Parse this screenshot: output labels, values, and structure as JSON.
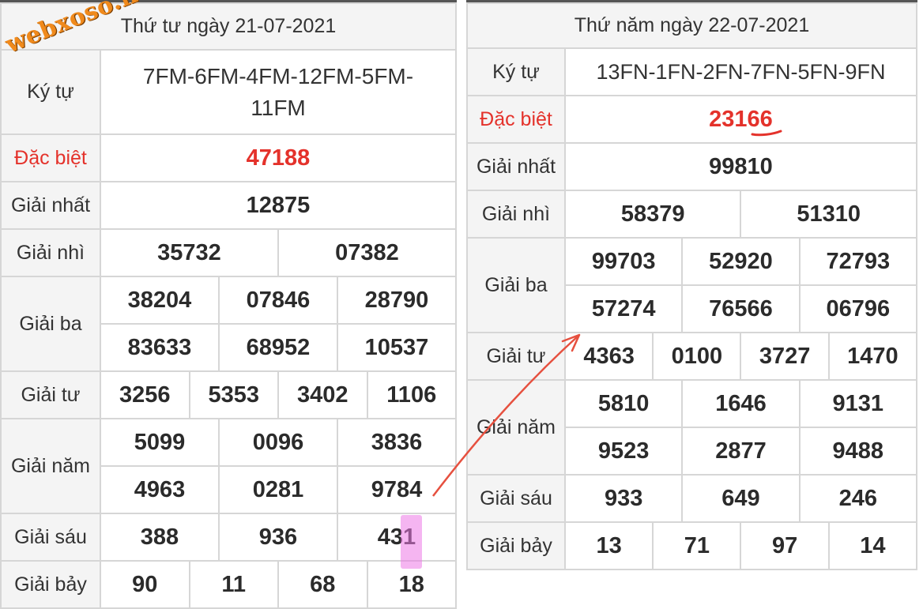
{
  "watermark": "webxoso.net",
  "left": {
    "header": "Thứ tư ngày 21-07-2021",
    "ky_tu_label": "Ký tự",
    "ky_tu_line1": "7FM-6FM-4FM-12FM-5FM-",
    "ky_tu_line2": "11FM",
    "dac_biet_label": "Đặc biệt",
    "dac_biet": "47188",
    "nhat_label": "Giải nhất",
    "nhat": "12875",
    "nhi_label": "Giải nhì",
    "nhi": [
      "35732",
      "07382"
    ],
    "ba_label": "Giải ba",
    "ba": [
      "38204",
      "07846",
      "28790",
      "83633",
      "68952",
      "10537"
    ],
    "tu_label": "Giải tư",
    "tu": [
      "3256",
      "5353",
      "3402",
      "1106"
    ],
    "nam_label": "Giải năm",
    "nam": [
      "5099",
      "0096",
      "3836",
      "4963",
      "0281",
      "9784"
    ],
    "sau_label": "Giải sáu",
    "sau": [
      "388",
      "936",
      "431"
    ],
    "bay_label": "Giải bảy",
    "bay": [
      "90",
      "11",
      "68",
      "18"
    ]
  },
  "right": {
    "header": "Thứ năm ngày 22-07-2021",
    "ky_tu_label": "Ký tự",
    "ky_tu": "13FN-1FN-2FN-7FN-5FN-9FN",
    "dac_biet_label": "Đặc biệt",
    "dac_biet": "23166",
    "nhat_label": "Giải nhất",
    "nhat": "99810",
    "nhi_label": "Giải nhì",
    "nhi": [
      "58379",
      "51310"
    ],
    "ba_label": "Giải ba",
    "ba": [
      "99703",
      "52920",
      "72793",
      "57274",
      "76566",
      "06796"
    ],
    "tu_label": "Giải tư",
    "tu": [
      "4363",
      "0100",
      "3727",
      "1470"
    ],
    "nam_label": "Giải năm",
    "nam": [
      "5810",
      "1646",
      "9131",
      "9523",
      "2877",
      "9488"
    ],
    "sau_label": "Giải sáu",
    "sau": [
      "933",
      "649",
      "246"
    ],
    "bay_label": "Giải bảy",
    "bay": [
      "13",
      "71",
      "97",
      "14"
    ]
  },
  "colors": {
    "accent_red": "#e4322b",
    "watermark": "#f08a1c",
    "highlight": "#ec78e6"
  }
}
